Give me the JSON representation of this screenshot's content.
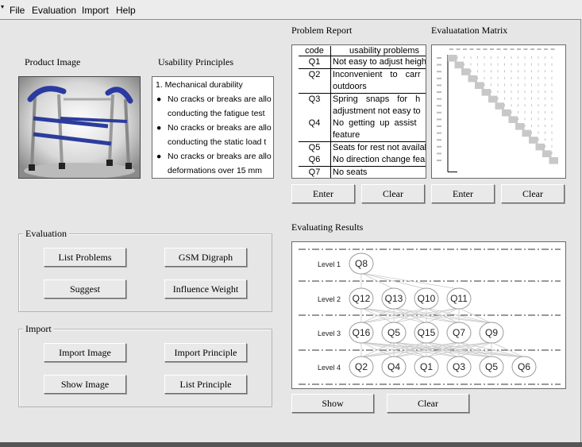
{
  "menu": [
    "File",
    "Evaluation",
    "Import",
    "Help"
  ],
  "product_image": {
    "label": "Product Image"
  },
  "usability_principles": {
    "label": "Usability Principles",
    "lines": [
      "1. Mechanical durability",
      "No cracks or breaks are allo",
      "conducting the fatigue test",
      "No cracks or breaks are allo",
      "conducting the static load t",
      "No cracks or breaks are allo",
      "deformations over 15 mm"
    ]
  },
  "problem_report": {
    "label": "Problem Report",
    "headers": [
      "code",
      "usability problems"
    ],
    "rows": [
      {
        "code": "Q1",
        "lines": [
          "Not easy to adjust heigh"
        ]
      },
      {
        "code": "Q2",
        "lines": [
          "Inconvenient to carr",
          "outdoors"
        ]
      },
      {
        "code": "Q3",
        "lines": [
          "Spring snaps for h",
          "adjustment not easy to"
        ]
      },
      {
        "code": "Q4",
        "lines": [
          "No getting up assist",
          "feature"
        ]
      },
      {
        "code": "Q5",
        "lines": [
          "Seats for rest not availab"
        ]
      },
      {
        "code": "Q6",
        "lines": [
          "No direction change fea"
        ]
      },
      {
        "code": "Q7",
        "lines": [
          "No seats"
        ]
      }
    ],
    "enter_label": "Enter",
    "clear_label": "Clear"
  },
  "evaluation_matrix": {
    "label": "Evaluatation Matrix",
    "enter_label": "Enter",
    "clear_label": "Clear"
  },
  "evaluation": {
    "title": "Evaluation",
    "list_problems": "List Problems",
    "gsm_digraph": "GSM Digraph",
    "suggest": "Suggest",
    "influence_weight": "Influence Weight"
  },
  "import": {
    "title": "Import",
    "import_image": "Import Image",
    "import_principle": "Import Principle",
    "show_image": "Show Image",
    "list_principle": "List Principle"
  },
  "evaluating_results": {
    "label": "Evaluating Results",
    "levels": [
      {
        "name": "Level 1",
        "nodes": [
          "Q8"
        ]
      },
      {
        "name": "Level 2",
        "nodes": [
          "Q12",
          "Q13",
          "Q10",
          "Q11"
        ]
      },
      {
        "name": "Level 3",
        "nodes": [
          "Q16",
          "Q5",
          "Q15",
          "Q7",
          "Q9"
        ]
      },
      {
        "name": "Level 4",
        "nodes": [
          "Q2",
          "Q4",
          "Q1",
          "Q3",
          "Q5",
          "Q6"
        ]
      }
    ],
    "show_label": "Show",
    "clear_label": "Clear"
  }
}
